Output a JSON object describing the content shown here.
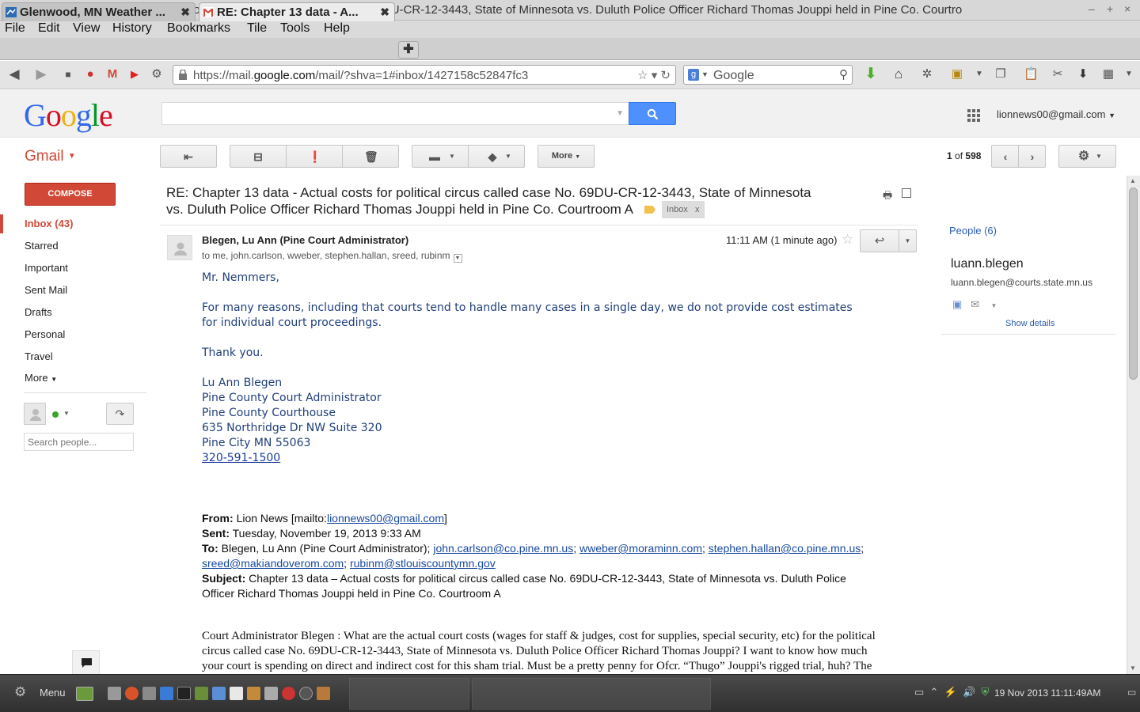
{
  "window": {
    "title": "RE: Chapter 13 data - Actual costs for political circus called case No. 69DU-CR-12-3443, State of Minnesota vs. Duluth Police Officer Richard Thomas Jouppi held in Pine Co. Courtro"
  },
  "menubar": [
    "File",
    "Edit",
    "View",
    "History",
    "Bookmarks",
    "Tile",
    "Tools",
    "Help"
  ],
  "tabs": [
    {
      "label": "Glenwood, MN Weather ..."
    },
    {
      "label": "RE: Chapter 13 data - A..."
    }
  ],
  "navbar": {
    "url_prefix": "https://mail.",
    "url_domain": "google.com",
    "url_suffix": "/mail/?shva=1#inbox/1427158c52847fc3",
    "search_engine": "Google"
  },
  "gmail": {
    "logo": "Google",
    "account": "lionnews00@gmail.com",
    "brand": "Gmail",
    "compose": "COMPOSE",
    "more_button": "More",
    "page_count_prefix": "1",
    "page_count_of": "of",
    "page_count_total": "598"
  },
  "nav": [
    {
      "label": "Inbox (43)",
      "selected": true
    },
    {
      "label": "Starred"
    },
    {
      "label": "Important"
    },
    {
      "label": "Sent Mail"
    },
    {
      "label": "Drafts"
    },
    {
      "label": "Personal"
    },
    {
      "label": "Travel"
    },
    {
      "label": "More"
    }
  ],
  "chat": {
    "search_placeholder": "Search people..."
  },
  "message": {
    "subject_line1": "RE: Chapter 13 data - Actual costs for political circus called case No. 69DU-CR-12-3443, State of Minnesota",
    "subject_line2": "vs. Duluth Police Officer Richard Thomas Jouppi held in Pine Co. Courtroom A",
    "inbox_label": "Inbox",
    "inbox_label_x": "x",
    "sender": "Blegen, Lu Ann (Pine Court Administrator)",
    "recipients": "to me, john.carlson, wweber, stephen.hallan, sreed, rubinm",
    "time": "11:11 AM (1 minute ago)",
    "greeting": "Mr. Nemmers,",
    "para1_line1": "For many reasons, including that courts tend to handle many cases in a single day, we do not provide cost estimates",
    "para1_line2": "for individual court proceedings.",
    "thanks": "Thank you.",
    "sig": [
      "Lu Ann Blegen",
      "Pine County Court Administrator",
      "Pine County Courthouse",
      "635 Northridge Dr NW Suite 320",
      "Pine City MN  55063"
    ],
    "phone": "320-591-1500",
    "fwd": {
      "from_label": "From:",
      "from_value": "Lion News [mailto:",
      "from_email": "lionnews00@gmail.com",
      "from_close": "]",
      "sent_label": "Sent:",
      "sent_value": "Tuesday, November 19, 2013 9:33 AM",
      "to_label": "To:",
      "to_value": "Blegen, Lu Ann (Pine Court Administrator);",
      "to_emails": [
        "john.carlson@co.pine.mn.us",
        "wweber@moraminn.com",
        "stephen.hallan@co.pine.mn.us",
        "sreed@makiandoverom.com",
        "rubinm@stlouiscountymn.gov"
      ],
      "subject_label": "Subject:",
      "subject_line1": "Chapter 13 data – Actual costs for political circus called case No. 69DU-CR-12-3443, State of Minnesota vs. Duluth Police",
      "subject_line2": "Officer Richard Thomas Jouppi held in Pine Co. Courtroom A",
      "body_line1": "Court Administrator Blegen : What are the actual court costs (wages for staff & judges, cost for supplies, special security, etc) for the political",
      "body_line2": "circus called case No. 69DU-CR-12-3443, State of Minnesota vs. Duluth Police Officer Richard Thomas Jouppi? I want to know how much",
      "body_line3": "your court is spending on direct and indirect cost for this sham trial. Must be a pretty penny for Ofcr. “Thugo” Jouppi's rigged trial, huh? The"
    }
  },
  "people": {
    "header": "People (6)",
    "name": "luann.blegen",
    "email": "luann.blegen@courts.state.mn.us",
    "show_details": "Show details"
  },
  "taskbar": {
    "menu": "Menu",
    "clock": "19 Nov 2013 11:11:49AM"
  },
  "colors": {
    "gmail_red": "#d14836",
    "google_blue": "#4d90fe",
    "link_blue": "#2a5db0"
  }
}
